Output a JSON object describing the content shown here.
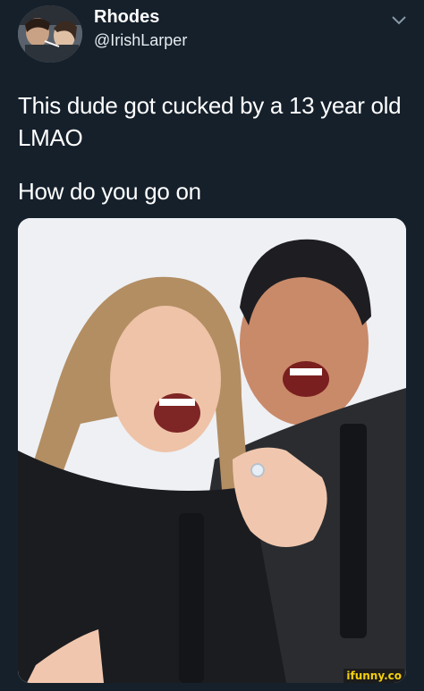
{
  "tweet": {
    "display_name": "Rhodes",
    "handle": "@IrishLarper",
    "line1": "This dude got cucked by a 13 year old LMAO",
    "line2": "How do you go on"
  },
  "icons": {
    "menu": "chevron-down-icon"
  },
  "watermark": "ifunny.co",
  "colors": {
    "background": "#15202b",
    "text": "#ffffff",
    "watermark_text": "#f5d10b"
  }
}
